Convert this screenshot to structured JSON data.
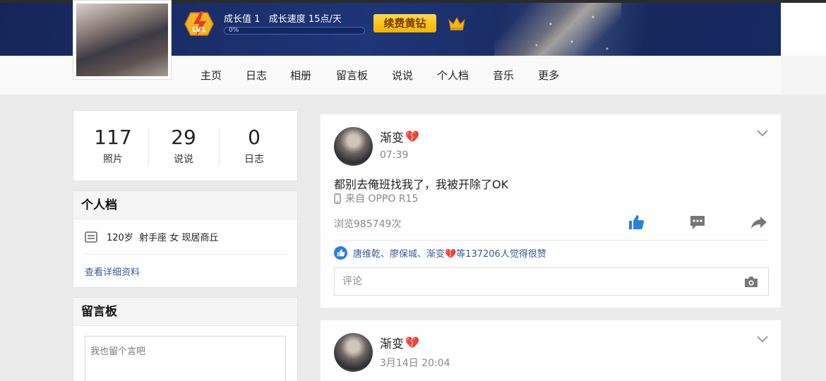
{
  "header": {
    "level_badge": "LV1",
    "growth_text": "成长值 1   成长速度 15点/天",
    "progress": {
      "fraction": 0.0,
      "label": "0%"
    },
    "renew_button": "续费黄钻",
    "icons": {
      "level": "level-lightning-badge-icon",
      "crown": "crown-icon"
    },
    "colors": {
      "banner": "#1c2d63",
      "renew": "#f3b400"
    }
  },
  "nav": {
    "items": [
      "主页",
      "日志",
      "相册",
      "留言板",
      "说说",
      "个人档",
      "音乐",
      "更多"
    ]
  },
  "stats": [
    {
      "value": "117",
      "label": "照片"
    },
    {
      "value": "29",
      "label": "说说"
    },
    {
      "value": "0",
      "label": "日志"
    }
  ],
  "profile": {
    "title": "个人档",
    "summary": "120岁  射手座 女 现居商丘",
    "detail_link": "查看详细资料",
    "icon": "profile-card-icon"
  },
  "guestbook": {
    "title": "留言板",
    "placeholder": "我也留个言吧"
  },
  "posts": [
    {
      "author": "渐变",
      "author_emoji": "💔",
      "time": "07:39",
      "text": "都别去俺班找我了，我被开除了OK",
      "device": "来自 OPPO R15",
      "views": "浏览985749次",
      "likes_text": "唐维乾、廖保城、渐变💔等137206人觉得很赞",
      "comment_placeholder": "评论",
      "icons": [
        "like-icon",
        "comment-icon",
        "share-icon",
        "camera-icon",
        "chevron-down-icon",
        "phone-icon"
      ]
    },
    {
      "author": "渐变",
      "author_emoji": "💔",
      "time": "3月14日 20:04"
    }
  ],
  "accent": {
    "link": "#3b5b91",
    "like_blue": "#2c7fd6"
  }
}
